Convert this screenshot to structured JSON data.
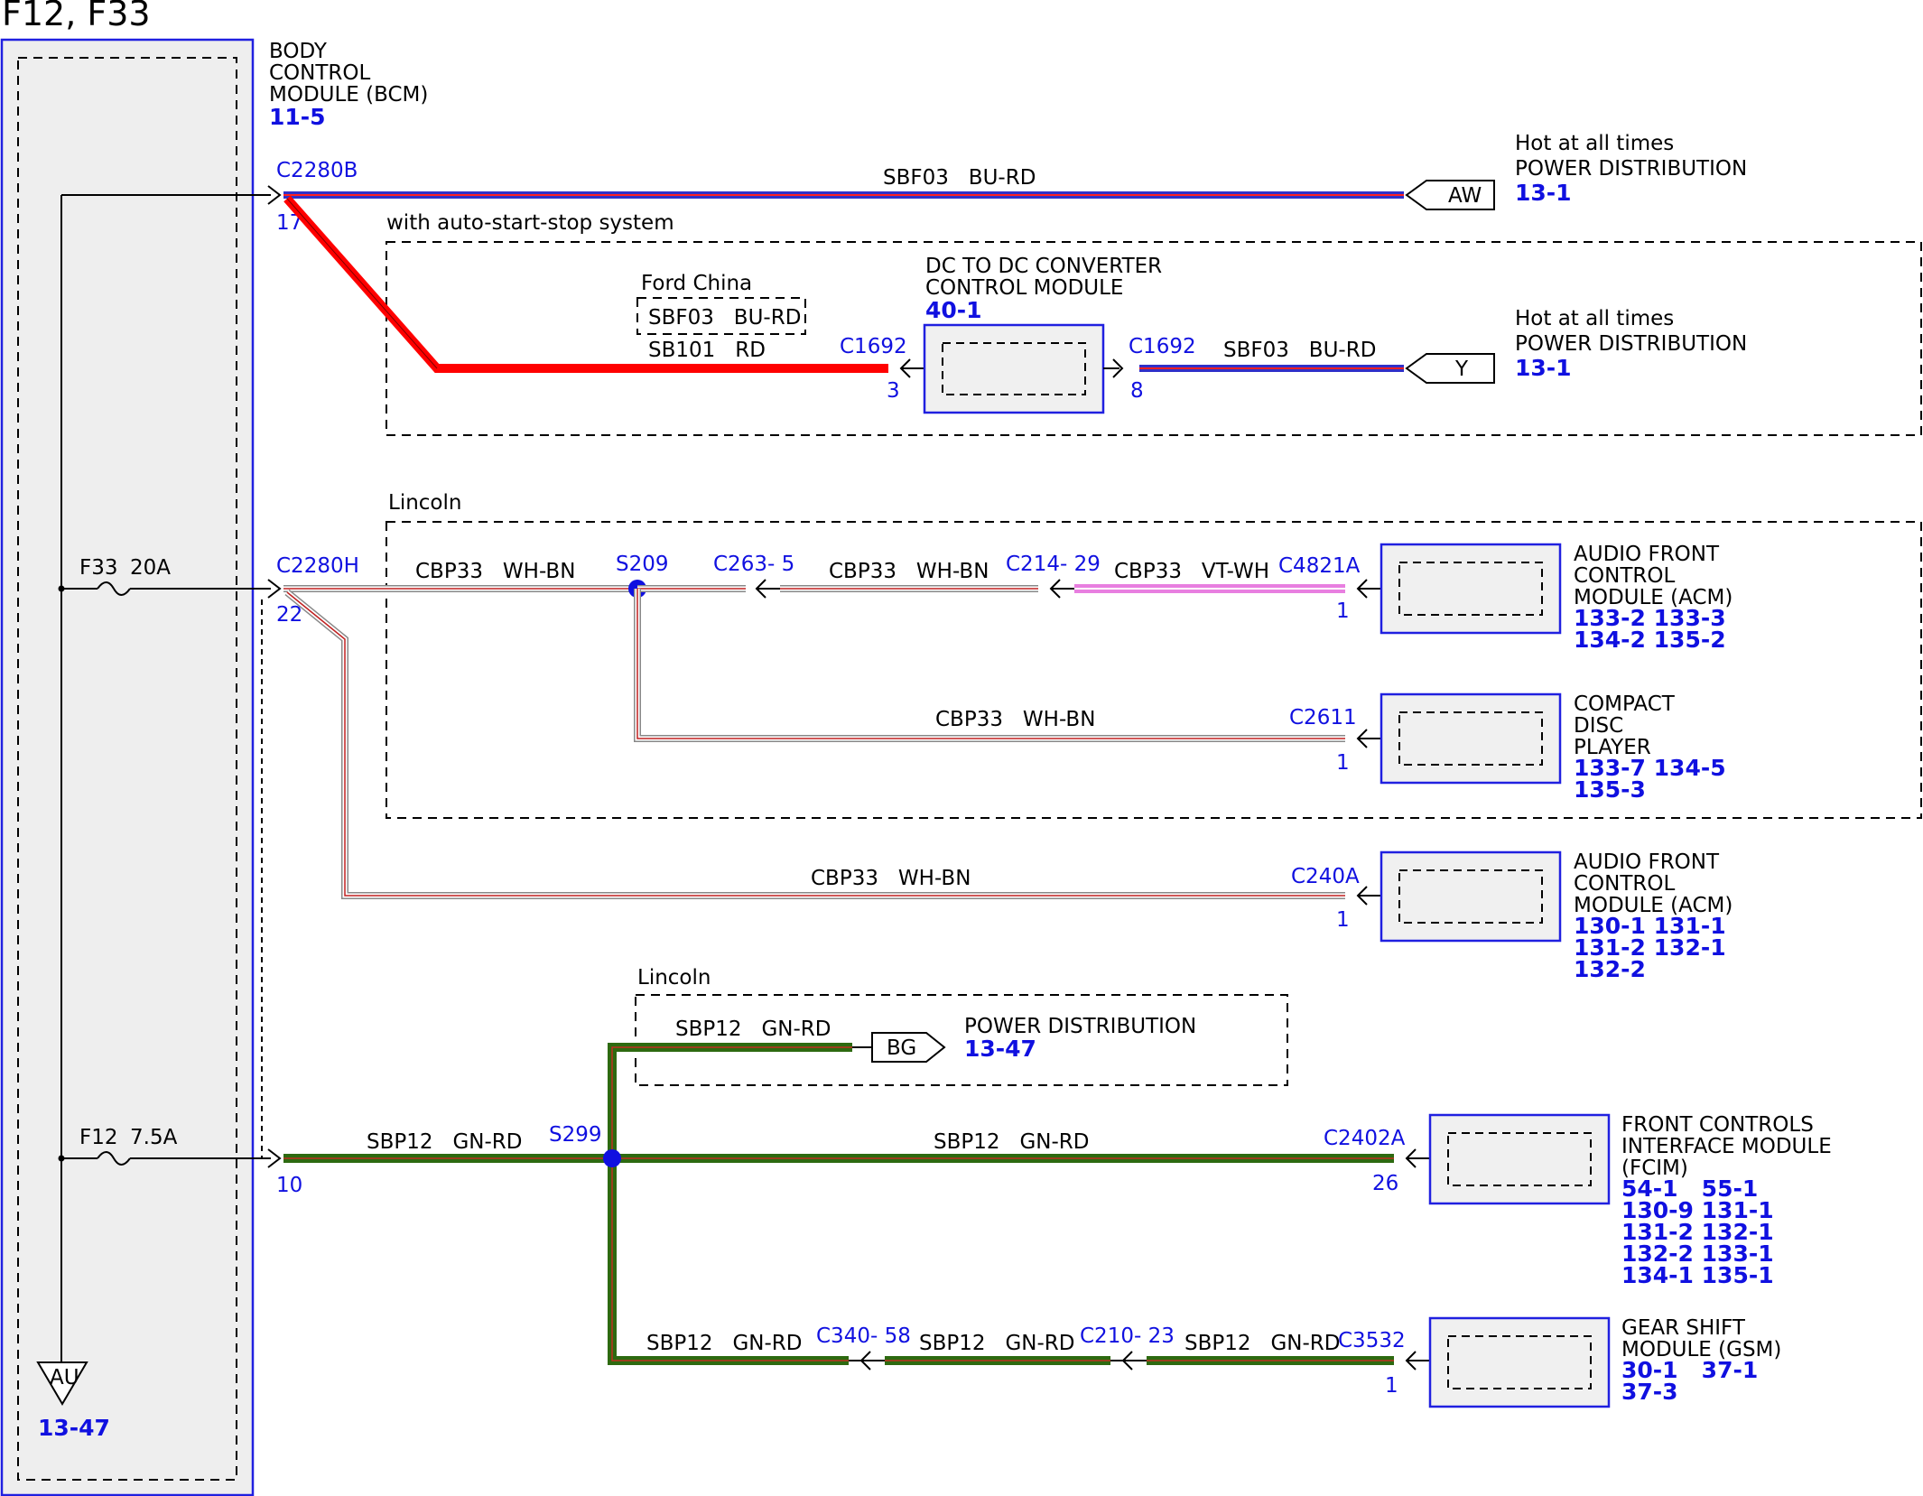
{
  "title": "F12, F33",
  "bcm": {
    "label": [
      "BODY",
      "CONTROL",
      "MODULE (BCM)"
    ],
    "ref": "11-5"
  },
  "fuses": {
    "f33": {
      "name": "F33",
      "rating": "20A"
    },
    "f12": {
      "name": "F12",
      "rating": "7.5A"
    }
  },
  "ground": {
    "label": "AU",
    "ref": "13-47"
  },
  "connectors": {
    "c2280b": {
      "name": "C2280B",
      "pin": "17"
    },
    "c2280h": {
      "name": "C2280H",
      "pin": "22"
    },
    "bcm_pin10": "10",
    "c1692_in": {
      "name": "C1692",
      "pin": "3"
    },
    "c1692_out": {
      "name": "C1692",
      "pin": "8"
    },
    "s209": "S209",
    "c263": "C263- 5",
    "c214": "C214- 29",
    "c4821a": {
      "name": "C4821A",
      "pin": "1"
    },
    "c2611": {
      "name": "C2611",
      "pin": "1"
    },
    "c240a": {
      "name": "C240A",
      "pin": "1"
    },
    "s299": "S299",
    "c2402a": {
      "name": "C2402A",
      "pin": "26"
    },
    "c340": "C340- 58",
    "c210": "C210- 23",
    "c3532": {
      "name": "C3532",
      "pin": "1"
    }
  },
  "wires": {
    "sbf03_top": "SBF03   BU-RD",
    "sb101": "SB101   RD",
    "ford_china": "SBF03   BU-RD",
    "sbf03_dc": "SBF03   BU-RD",
    "cbp33_a": "CBP33   WH-BN",
    "cbp33_b": "CBP33   WH-BN",
    "cbp33_vt": "CBP33   VT-WH",
    "cbp33_cd": "CBP33   WH-BN",
    "cbp33_acm2": "CBP33   WH-BN",
    "sbp12_bg": "SBP12   GN-RD",
    "sbp12_main": "SBP12   GN-RD",
    "sbp12_fcim": "SBP12   GN-RD",
    "sbp12_g1": "SBP12   GN-RD",
    "sbp12_g2": "SBP12   GN-RD",
    "sbp12_g3": "SBP12   GN-RD"
  },
  "wire_colors": {
    "blue": "#3030c8",
    "red": "#ff0000",
    "green": "#2d6a10",
    "pink": "#e87fe0",
    "brown": "#b04030"
  },
  "groups": {
    "auto_start": "with auto-start-stop system",
    "ford_china": "Ford China",
    "lincoln1": "Lincoln",
    "lincoln2": "Lincoln"
  },
  "power_aw": {
    "tag": "AW",
    "lines": [
      "Hot at all times",
      "POWER DISTRIBUTION"
    ],
    "ref": "13-1"
  },
  "power_y": {
    "tag": "Y",
    "lines": [
      "Hot at all times",
      "POWER DISTRIBUTION"
    ],
    "ref": "13-1"
  },
  "power_bg": {
    "tag": "BG",
    "line": "POWER DISTRIBUTION",
    "ref": "13-47"
  },
  "modules": {
    "dcdc": {
      "lines": [
        "DC TO DC CONVERTER",
        "CONTROL MODULE"
      ],
      "refs": [
        "40-1"
      ]
    },
    "acm1": {
      "lines": [
        "AUDIO FRONT",
        "CONTROL",
        "MODULE (ACM)"
      ],
      "refs": [
        "133-2 133-3",
        "134-2 135-2"
      ]
    },
    "cd": {
      "lines": [
        "COMPACT",
        "DISC",
        "PLAYER"
      ],
      "refs": [
        "133-7 134-5",
        "135-3"
      ]
    },
    "acm2": {
      "lines": [
        "AUDIO FRONT",
        "CONTROL",
        "MODULE (ACM)"
      ],
      "refs": [
        "130-1 131-1",
        "131-2 132-1",
        "132-2"
      ]
    },
    "fcim": {
      "lines": [
        "FRONT CONTROLS",
        "INTERFACE MODULE",
        "(FCIM)"
      ],
      "refs": [
        "54-1   55-1",
        "130-9 131-1",
        "131-2 132-1",
        "132-2 133-1",
        "134-1 135-1"
      ]
    },
    "gsm": {
      "lines": [
        "GEAR SHIFT",
        "MODULE (GSM)"
      ],
      "refs": [
        "30-1   37-1",
        "37-3"
      ]
    }
  }
}
